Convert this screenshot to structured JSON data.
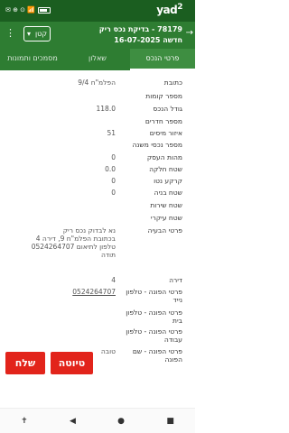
{
  "statusbar": {
    "icons_left": "✉ ⊕ ⊙ 📶",
    "battery_icon": "battery-icon",
    "brand_text": "yad",
    "brand_num": "2"
  },
  "header": {
    "title": "78179 - בדיקת נכס ריק",
    "subtitle": "חדשה 16-07-2025",
    "dropdown_value": "קטן",
    "dropdown_icon": "chevron-down-icon",
    "menu_icon": "kebab-menu-icon",
    "back_icon": "back-arrow-icon"
  },
  "tabs": [
    {
      "label": "פרטי הנכס",
      "active": true
    },
    {
      "label": "שאלון",
      "active": false
    },
    {
      "label": "מסמכים ותמונות",
      "active": false
    }
  ],
  "fields": [
    {
      "label": "כתובת",
      "value": "הפלמ\"ח 9/4"
    },
    {
      "label": "מספר קומות",
      "value": ""
    },
    {
      "label": "גודל הנכס",
      "value": "118.0"
    },
    {
      "label": "מספר חדרים",
      "value": ""
    },
    {
      "label": "איזור מיסים",
      "value": "51"
    },
    {
      "label": "מספר נכסי משנה",
      "value": ""
    },
    {
      "label": "מהות העסק",
      "value": "0"
    },
    {
      "label": "שטח חלקה",
      "value": "0.0"
    },
    {
      "label": "קרקע נטו",
      "value": "0"
    },
    {
      "label": "שטח בניה",
      "value": "0"
    },
    {
      "label": "שטח שירות",
      "value": ""
    },
    {
      "label": "שטח עיקרי",
      "value": ""
    }
  ],
  "contact": {
    "renter_label": "פרטי הבעיה",
    "renter_value_line1": "נא לבדוק נכס ריק",
    "renter_value_line2": "בכתובת הפלמ\"ח 9, דירה 4",
    "renter_value_line3": "טלפון לתיאום 0524264707",
    "renter_value_line4": "תודה",
    "apartment_label": "דירה",
    "apartment_value": "4",
    "mobile_label": "פרטי הפונה - טלפון נייד",
    "mobile_value": "0524264707",
    "home_label": "פרטי הפונה - טלפון בית",
    "home_value": "",
    "work_label": "פרטי הפונה - טלפון עבודה",
    "work_value": "",
    "name_label": "פרטי הפונה - שם הפונה",
    "name_value": "טובה"
  },
  "buttons": {
    "draft": "טיוטה",
    "send": "שלח"
  },
  "navbar": {
    "accessibility": "✝",
    "back": "◀",
    "home": "●",
    "recents": "■"
  }
}
